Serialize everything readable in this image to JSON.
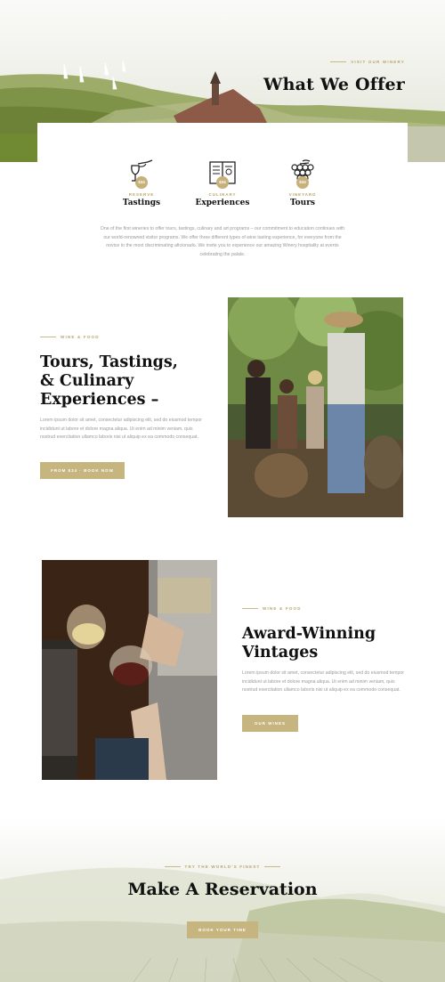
{
  "hero": {
    "eyebrow": "VISIT OUR WINERY",
    "title": "What We Offer"
  },
  "offers": [
    {
      "icon": "wine-glass-icon",
      "badge": "$34",
      "tag": "RESERVE",
      "name": "Tastings"
    },
    {
      "icon": "menu-book-icon",
      "badge": "$34",
      "tag": "CULINARY",
      "name": "Experiences"
    },
    {
      "icon": "grapes-icon",
      "badge": "$34",
      "tag": "VINEYARD",
      "name": "Tours"
    }
  ],
  "offer_text": "One of the first wineries to offer tours, tastings, culinary and art programs – our commitment to education continues with our world-renowned visitor programs. We offer three different types of wine tasting experience, for everyone from the novice to the most discriminating aficionado. We invite you to experience our amazing Winery hospitality at events celebrating the palate.",
  "tours": {
    "eyebrow": "WINE & FOOD",
    "title_lines": [
      "Tours, Tastings,",
      "& Culinary",
      "Experiences –"
    ],
    "text": "Lorem ipsum dolor sit amet, consectetur adipiscing elit, sed do eiusmod tempor incididunt ut labore et dolore magna aliqua. Ut enim ad minim veniam, quis nostrud exercitation ullamco laboris nisi ut aliquip ex ea commodo consequat.",
    "button": "FROM $34 · BOOK NOW"
  },
  "vintages": {
    "eyebrow": "WINE & FOOD",
    "title_lines": [
      "Award-Winning",
      "Vintages"
    ],
    "text": "Lorem ipsum dolor sit amet, consectetur adipiscing elit, sed do eiusmod tempor incididunt ut labore et dolore magna aliqua. Ut enim ad minim veniam, quis nostrud exercitation ullamco laboris nisi ut aliquip ex ea commodo consequat.",
    "button": "OUR WINES"
  },
  "reservation": {
    "eyebrow": "TRY THE WORLD'S FINEST",
    "title": "Make A Reservation",
    "button": "BOOK YOUR TIME"
  },
  "colors": {
    "accent": "#c7b580",
    "eyebrow": "#b9a56a",
    "text": "#111111"
  }
}
